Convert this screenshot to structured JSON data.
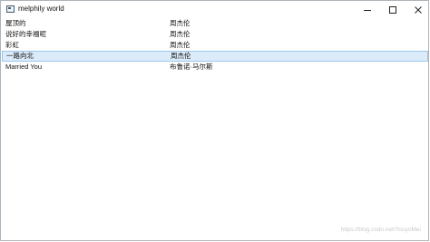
{
  "window": {
    "title": "melphily world"
  },
  "songs": [
    {
      "title": "屋顶的",
      "artist": "周杰伦"
    },
    {
      "title": "说好的幸福呢",
      "artist": "周杰伦"
    },
    {
      "title": "彩虹",
      "artist": "周杰伦"
    },
    {
      "title": "一路向北",
      "artist": "周杰伦",
      "selected": true
    },
    {
      "title": "Married You",
      "artist": "布鲁诺·马尔斯"
    }
  ],
  "watermark": "https://blog.csdn.net/YouyoMei",
  "colors": {
    "selected_background": "#dcebfa",
    "selected_border": "#9cc7ee",
    "top_strip": "#2b2d30"
  },
  "icons": {
    "app": "app-window-icon",
    "minimize": "minimize-icon",
    "maximize": "maximize-icon",
    "close": "close-icon"
  }
}
